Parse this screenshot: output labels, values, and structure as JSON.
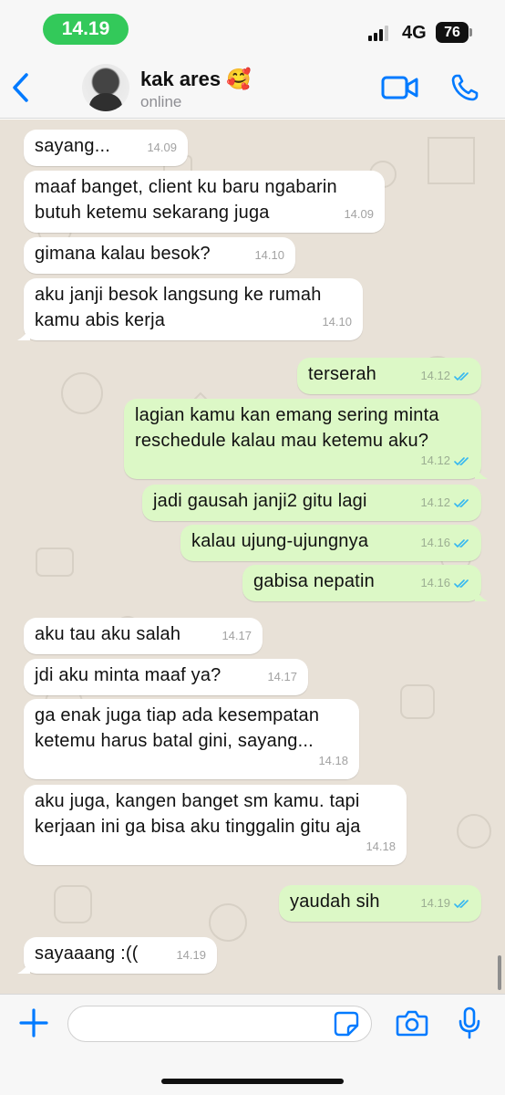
{
  "status_bar": {
    "time": "14.19",
    "network": "4G",
    "battery": "76"
  },
  "header": {
    "contact_name": "kak ares 🥰",
    "contact_status": "online"
  },
  "messages": [
    {
      "dir": "in",
      "text": "sayang...",
      "time": "14.09"
    },
    {
      "dir": "in",
      "text": "maaf banget, client ku baru ngabarin\nbutuh ketemu sekarang juga",
      "time": "14.09"
    },
    {
      "dir": "in",
      "text": "gimana kalau besok?",
      "time": "14.10"
    },
    {
      "dir": "in",
      "text": "aku janji besok langsung ke rumah\nkamu abis kerja",
      "time": "14.10"
    },
    {
      "dir": "out",
      "text": "terserah",
      "time": "14.12"
    },
    {
      "dir": "out",
      "text": "lagian kamu kan emang sering minta\nreschedule kalau mau ketemu aku?",
      "time": "14.12"
    },
    {
      "dir": "out",
      "text": "jadi gausah janji2 gitu lagi",
      "time": "14.12"
    },
    {
      "dir": "out",
      "text": "kalau ujung-ujungnya",
      "time": "14.16"
    },
    {
      "dir": "out",
      "text": "gabisa nepatin",
      "time": "14.16"
    },
    {
      "dir": "in",
      "text": "aku tau aku salah",
      "time": "14.17"
    },
    {
      "dir": "in",
      "text": "jdi aku minta maaf ya?",
      "time": "14.17"
    },
    {
      "dir": "in",
      "text": "ga enak juga tiap ada kesempatan\nketemu harus batal gini, sayang...",
      "time": "14.18"
    },
    {
      "dir": "in",
      "text": "aku juga, kangen banget sm kamu. tapi\nkerjaan ini ga bisa aku tinggalin gitu aja",
      "time": "14.18"
    },
    {
      "dir": "out",
      "text": "yaudah sih",
      "time": "14.19"
    },
    {
      "dir": "in",
      "text": "sayaaang :((",
      "time": "14.19"
    }
  ],
  "input_bar": {
    "message_value": ""
  },
  "colors": {
    "accent": "#007aff",
    "outgoing_bubble": "#dcf8c6",
    "incoming_bubble": "#ffffff",
    "read_ticks": "#34b7f1",
    "chat_bg": "#e8e1d7",
    "status_pill": "#33c95a"
  },
  "icons": {
    "back": "chevron-left-icon",
    "video": "video-camera-icon",
    "call": "phone-icon",
    "plus": "plus-icon",
    "sticker": "sticker-icon",
    "camera": "camera-icon",
    "mic": "microphone-icon"
  }
}
